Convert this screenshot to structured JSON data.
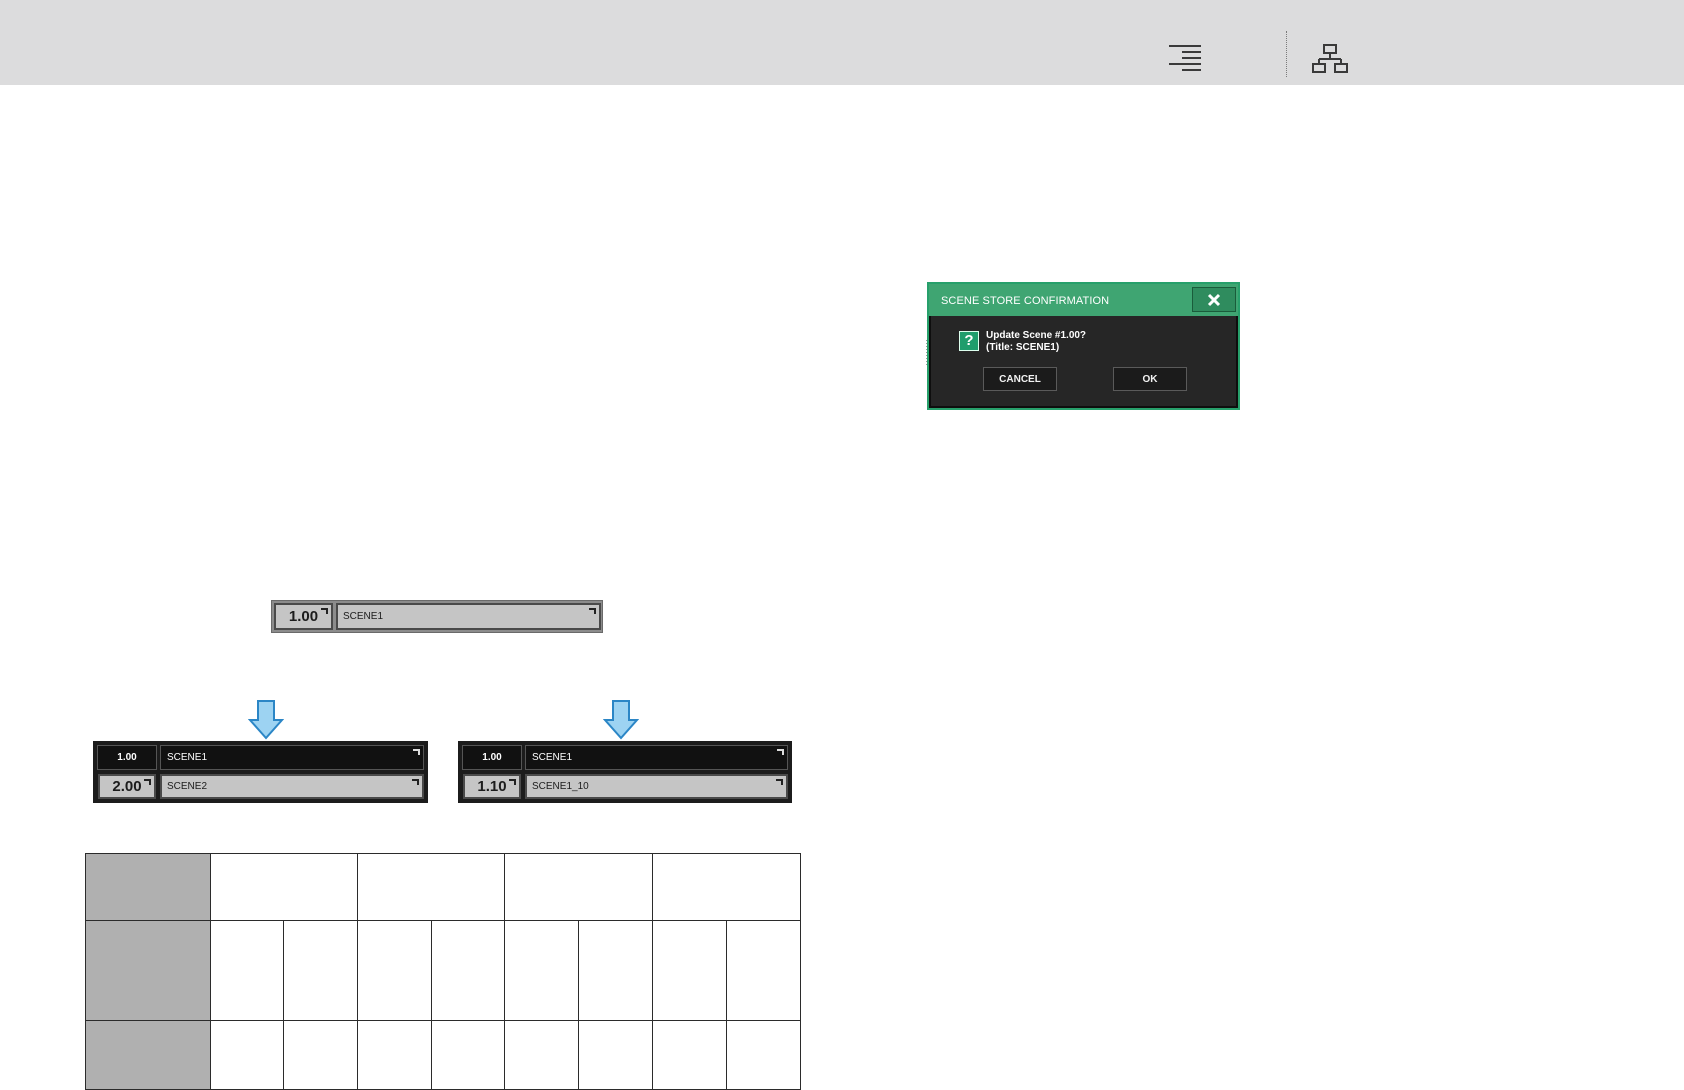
{
  "toolbar": {
    "icons": [
      "align-right-lines-icon",
      "sitemap-hierarchy-icon"
    ]
  },
  "dialog": {
    "title": "SCENE STORE CONFIRMATION",
    "close_icon": "close-icon",
    "question_icon": "?",
    "message_line1": "Update Scene #1.00?",
    "message_line2": "(Title: SCENE1)",
    "cancel_label": "CANCEL",
    "ok_label": "OK",
    "colors": {
      "header": "#3fa572",
      "body": "#262626",
      "border": "#27a06b"
    }
  },
  "current_scene": {
    "number": "1.00",
    "title": "SCENE1"
  },
  "result_left": {
    "top_number": "1.00",
    "top_title": "SCENE1",
    "bottom_number": "2.00",
    "bottom_title": "SCENE2"
  },
  "result_right": {
    "top_number": "1.00",
    "top_title": "SCENE1",
    "bottom_number": "1.10",
    "bottom_title": "SCENE1_10"
  },
  "table": {
    "rows": 3
  }
}
